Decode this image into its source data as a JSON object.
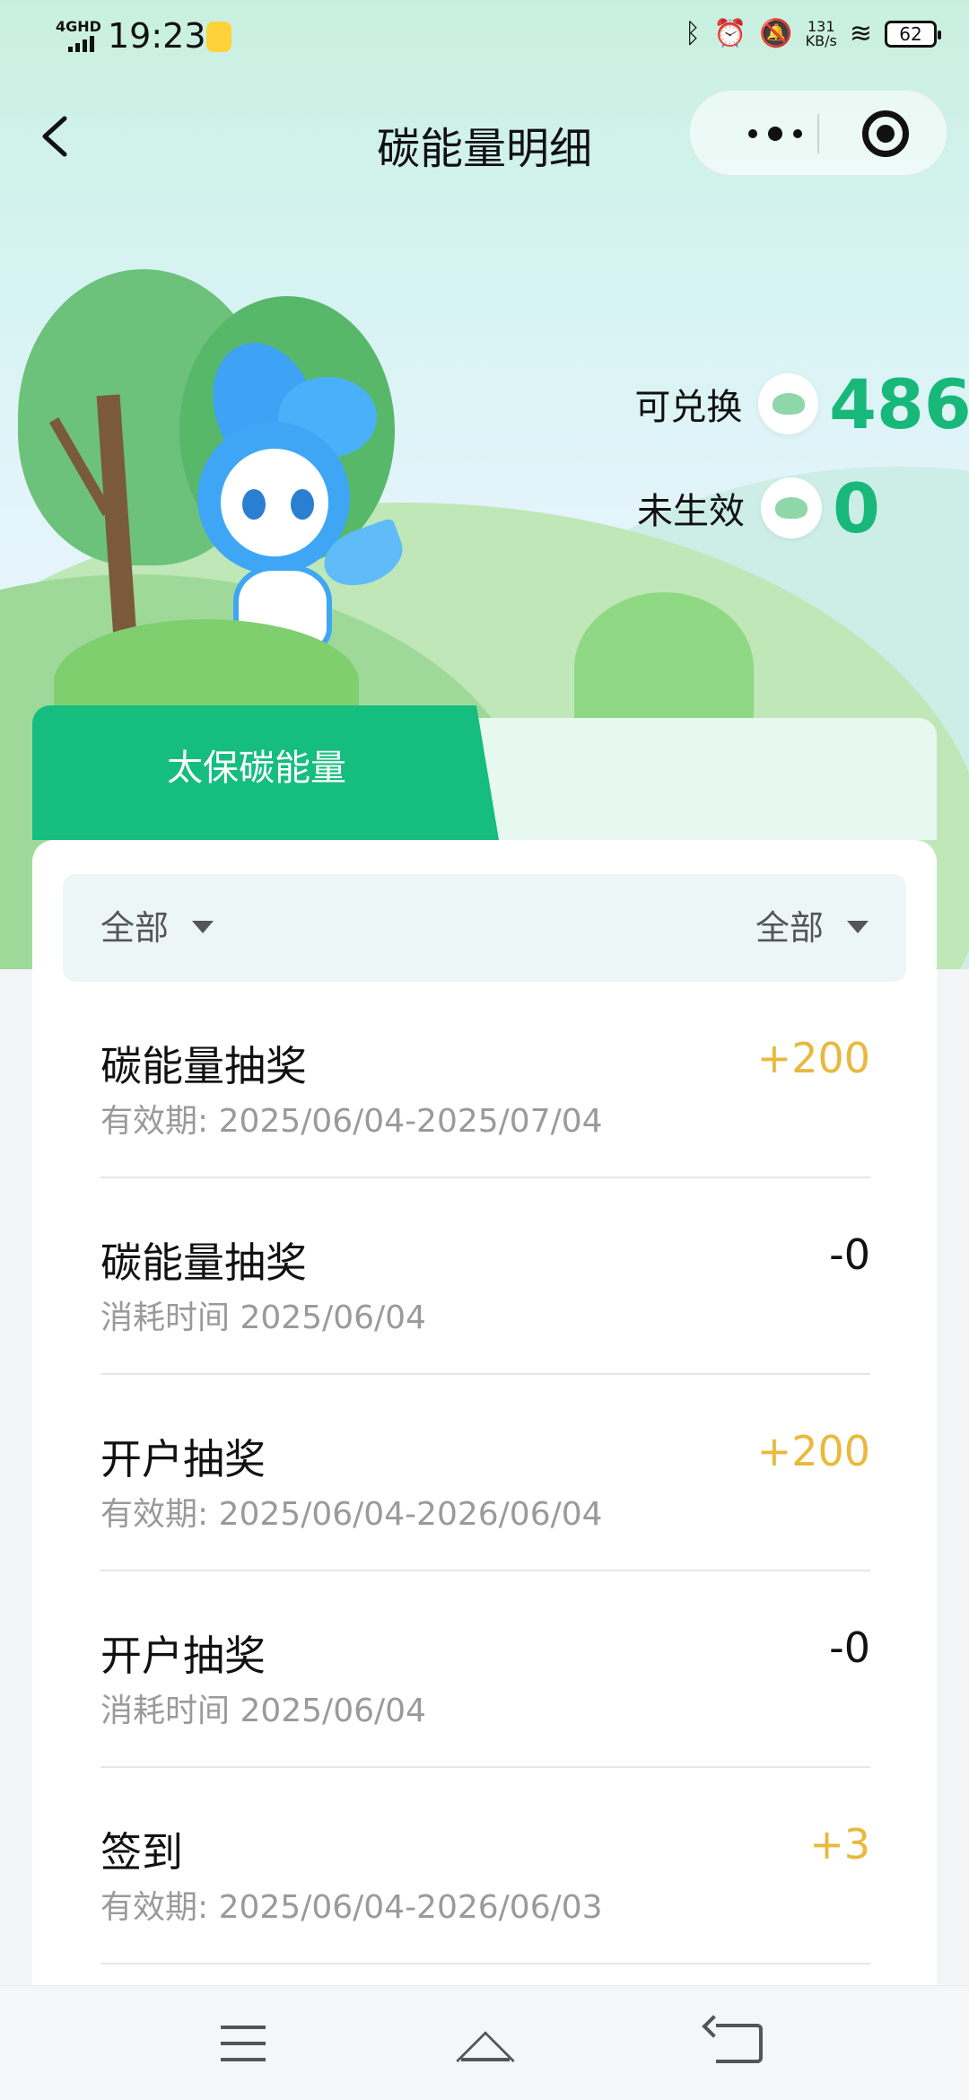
{
  "status_bar": {
    "network": "4GHD",
    "time": "19:23",
    "speed_value": "131",
    "speed_unit": "KB/s",
    "battery": "62"
  },
  "nav": {
    "title": "碳能量明细"
  },
  "balance": {
    "available_label": "可兑换",
    "available_value": "486",
    "pending_label": "未生效",
    "pending_value": "0"
  },
  "tabs": [
    {
      "label": "太保碳能量",
      "active": true
    },
    {
      "label": "",
      "active": false
    }
  ],
  "filters": {
    "left": "全部",
    "right": "全部"
  },
  "records": [
    {
      "name": "碳能量抽奖",
      "sub": "有效期: 2025/06/04-2025/07/04",
      "amount": "+200",
      "kind": "plus"
    },
    {
      "name": "碳能量抽奖",
      "sub": "消耗时间 2025/06/04",
      "amount": "-0",
      "kind": "minus"
    },
    {
      "name": "开户抽奖",
      "sub": "有效期: 2025/06/04-2026/06/04",
      "amount": "+200",
      "kind": "plus"
    },
    {
      "name": "开户抽奖",
      "sub": "消耗时间 2025/06/04",
      "amount": "-0",
      "kind": "minus"
    },
    {
      "name": "签到",
      "sub": "有效期: 2025/06/04-2026/06/03",
      "amount": "+3",
      "kind": "plus"
    }
  ],
  "colors": {
    "accent_green": "#15bd7f",
    "balance_green": "#18b87a",
    "plus_amount": "#e8b93d",
    "minus_amount": "#111111"
  },
  "icons": {
    "back": "chevron-left-icon",
    "more": "more-dots-icon",
    "close_miniapp": "target-circle-icon",
    "coin": "leaf-coin-icon",
    "dropdown": "triangle-down-icon"
  }
}
